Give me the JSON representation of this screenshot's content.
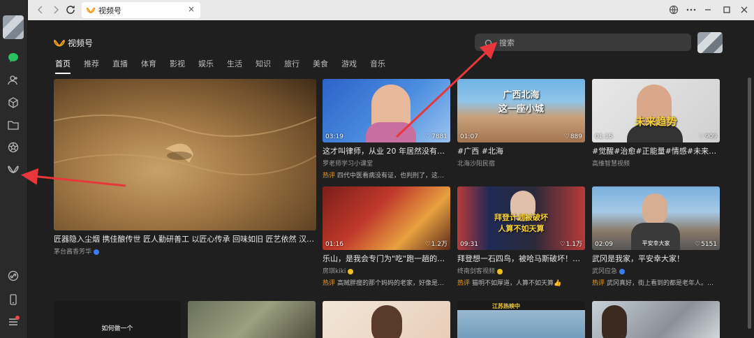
{
  "browser": {
    "tab_title": "视频号",
    "tab_close": "×"
  },
  "rail": {
    "icons": [
      "chat-icon",
      "contacts-icon",
      "cube-icon",
      "folder-icon",
      "aperture-icon",
      "channels-icon",
      "link-icon",
      "phone-icon",
      "menu-icon"
    ]
  },
  "header": {
    "brand": "视频号",
    "search_placeholder": "搜索"
  },
  "categories": [
    "首页",
    "推荐",
    "直播",
    "体育",
    "影视",
    "娱乐",
    "生活",
    "知识",
    "旅行",
    "美食",
    "游戏",
    "音乐"
  ],
  "featured": {
    "title": "匠器隐入尘烟 携佳酿传世 匠人勤研善工 以匠心传承 回味如旧 匠艺依然 汉酱…",
    "author": "茅台酱香芳华"
  },
  "videos": [
    {
      "duration": "03:19",
      "likes": "7881",
      "title": "这才叫律师，从业 20 年居然没有律…",
      "author": "罗老师学习小课堂",
      "hot_label": "热评",
      "hot_text": "四代中医看病没有证，也判刑了，这…"
    },
    {
      "duration": "01:07",
      "likes": "889",
      "caption_l1": "广西北海",
      "caption_l2": "这一座小城",
      "title": "#广西 #北海",
      "author": "北海沙阳民宿"
    },
    {
      "duration": "01:15",
      "likes": "909",
      "caption_l1": "未来趋势",
      "title": "#觉醒#治愈#正能量#情感#未来#成…",
      "author": "高维智慧视频"
    },
    {
      "duration": "01:16",
      "likes": "1.2万",
      "title": "乐山，是我会专门为\"吃\"跑一趟的地…",
      "author": "房琪kiki",
      "hot_label": "热评",
      "hot_text": "高贼胖瘦的那个妈妈的老家，好像是…"
    },
    {
      "duration": "09:31",
      "likes": "1.1万",
      "caption_l1": "拜登计划被破坏",
      "caption_l2": "人算不如天算",
      "title": "拜登想一石四鸟，被哈马斯破坏！美…",
      "author": "终南剑客视频",
      "hot_label": "热评",
      "hot_text": "猫明不如厚道，人算不如天算👍"
    },
    {
      "duration": "02:09",
      "likes": "5151",
      "caption_l1": "平安幸大家",
      "title": "武冈是我家，平安幸大家！",
      "author": "武冈应急",
      "hot_label": "热评",
      "hot_text": "武冈真好，街上看到的都是老年人。…"
    }
  ],
  "bottom_row": {
    "card1_caption_l1": "如何做一个",
    "card5_caption": "江苏热映中"
  },
  "colors": {
    "accent": "#f0a020",
    "bg": "#1f1f1f",
    "rail": "#2a2a2a",
    "arrow": "#e8363a"
  }
}
